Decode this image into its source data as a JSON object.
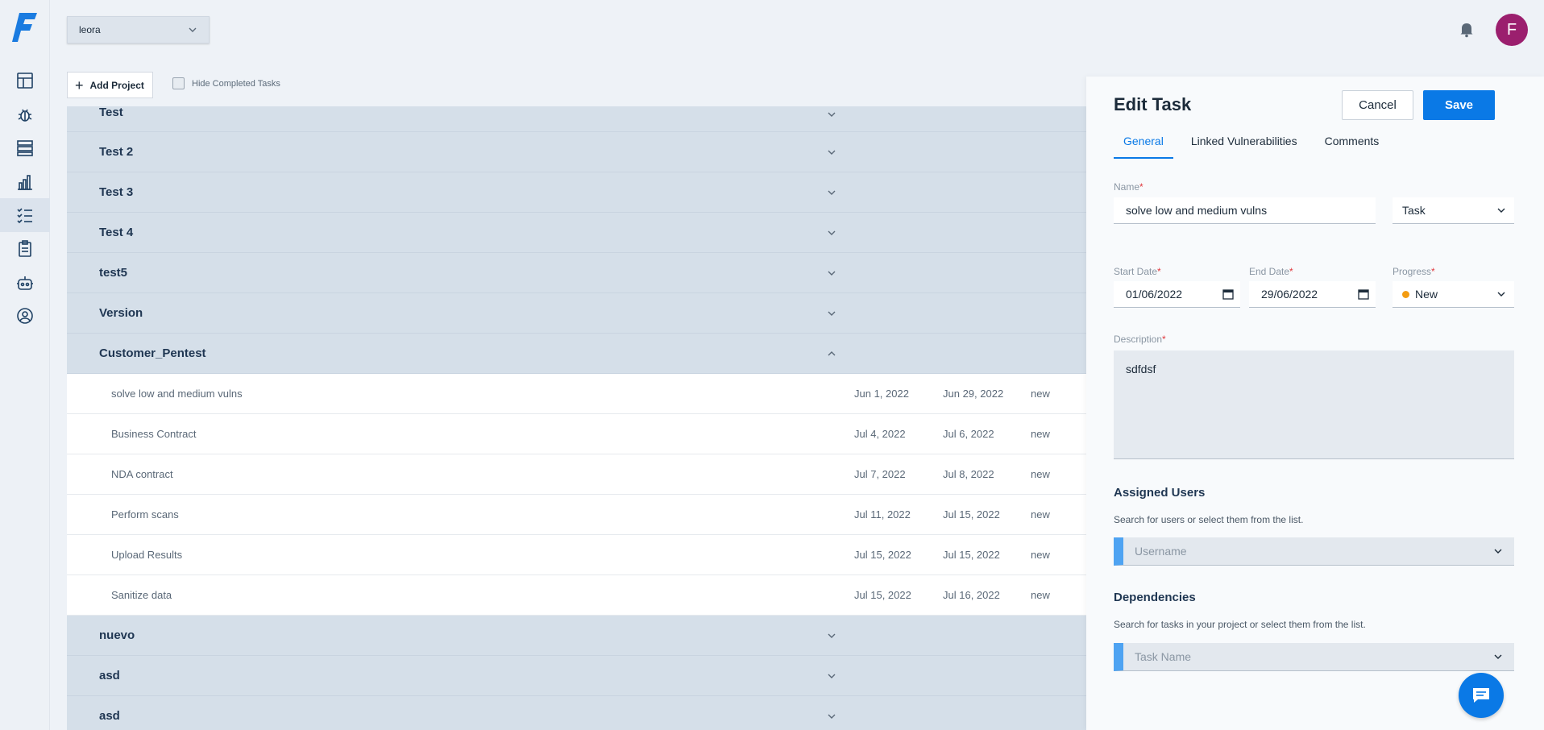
{
  "workspace": {
    "selected": "leora"
  },
  "toolbar": {
    "add_project_label": "Add Project",
    "hide_completed_label": "Hide Completed Tasks",
    "hide_completed_checked": false
  },
  "user": {
    "avatar_initial": "F"
  },
  "projects": [
    {
      "name": "Test",
      "expanded": false
    },
    {
      "name": "Test 2",
      "expanded": false
    },
    {
      "name": "Test 3",
      "expanded": false
    },
    {
      "name": "Test 4",
      "expanded": false
    },
    {
      "name": "test5",
      "expanded": false
    },
    {
      "name": "Version",
      "expanded": false
    },
    {
      "name": "Customer_Pentest",
      "expanded": true
    },
    {
      "name": "nuevo",
      "expanded": false
    },
    {
      "name": "asd",
      "expanded": false
    },
    {
      "name": "asd",
      "expanded": false
    }
  ],
  "tasks": [
    {
      "name": "solve low and medium vulns",
      "start": "Jun 1, 2022",
      "end": "Jun 29, 2022",
      "status": "new"
    },
    {
      "name": "Business Contract",
      "start": "Jul 4, 2022",
      "end": "Jul 6, 2022",
      "status": "new"
    },
    {
      "name": "NDA contract",
      "start": "Jul 7, 2022",
      "end": "Jul 8, 2022",
      "status": "new"
    },
    {
      "name": "Perform scans",
      "start": "Jul 11, 2022",
      "end": "Jul 15, 2022",
      "status": "new"
    },
    {
      "name": "Upload Results",
      "start": "Jul 15, 2022",
      "end": "Jul 15, 2022",
      "status": "new"
    },
    {
      "name": "Sanitize data",
      "start": "Jul 15, 2022",
      "end": "Jul 16, 2022",
      "status": "new"
    }
  ],
  "edit_task": {
    "title": "Edit Task",
    "cancel_label": "Cancel",
    "save_label": "Save",
    "tabs": [
      "General",
      "Linked Vulnerabilities",
      "Comments"
    ],
    "active_tab": "General",
    "name_label": "Name",
    "name_value": "solve low and medium vulns",
    "type_value": "Task",
    "start_label": "Start Date",
    "start_value": "01/06/2022",
    "end_label": "End Date",
    "end_value": "29/06/2022",
    "progress_label": "Progress",
    "progress_value": "New",
    "description_label": "Description",
    "description_value": "sdfdsf",
    "assigned_title": "Assigned Users",
    "assigned_hint": "Search for users or select them from the list.",
    "assigned_placeholder": "Username",
    "deps_title": "Dependencies",
    "deps_hint": "Search for tasks in your project or select them from the list.",
    "deps_placeholder": "Task Name",
    "required_mark": "*"
  },
  "colors": {
    "accent": "#0a79e6",
    "avatar": "#9b1f6e",
    "progress_dot": "#f39c12",
    "required": "#e0393e"
  },
  "icons": [
    "logo-icon",
    "dashboard-icon",
    "bug-icon",
    "server-icon",
    "chart-icon",
    "tasks-icon",
    "clipboard-icon",
    "robot-icon",
    "user-circle-icon",
    "bell-icon",
    "chat-icon"
  ]
}
